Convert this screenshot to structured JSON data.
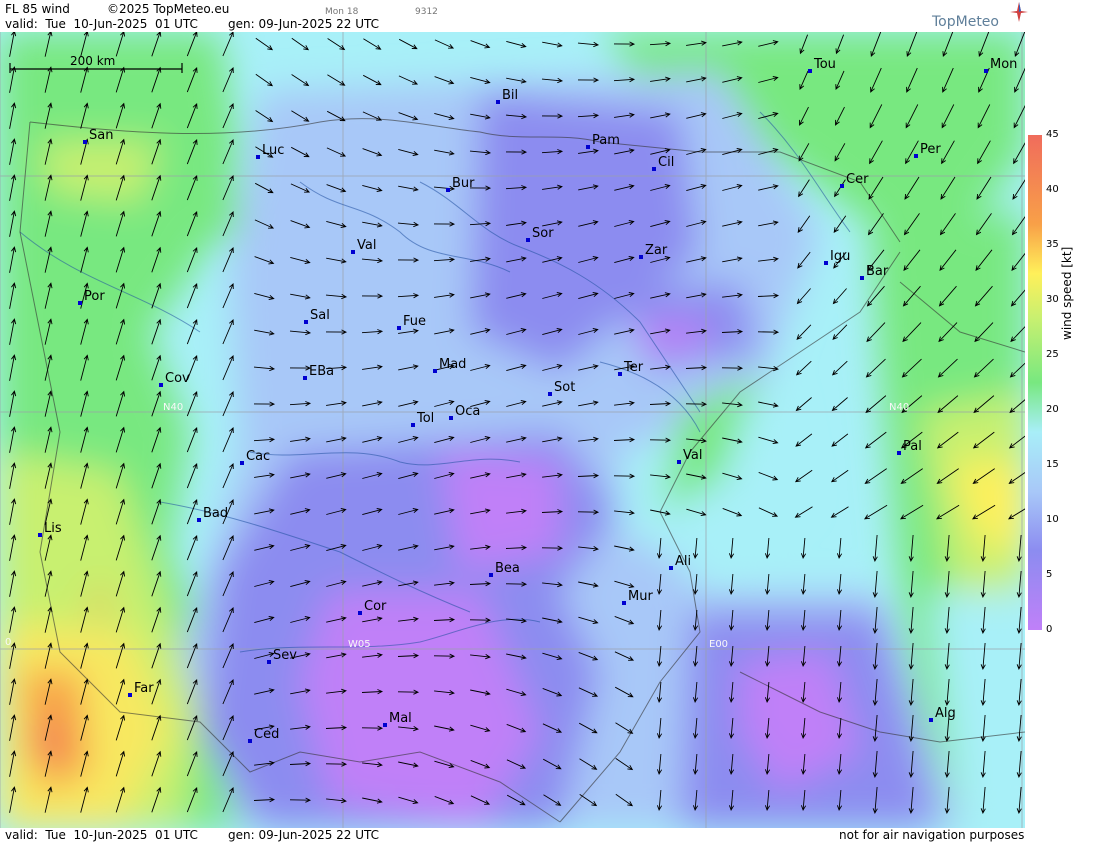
{
  "header": {
    "product": "FL 85 wind",
    "copyright": "©2025 TopMeteo.eu",
    "model_tag": "Mon 18",
    "code": "9312",
    "valid": "valid:  Tue  10-Jun-2025  01 UTC",
    "gen": "gen: 09-Jun-2025 22 UTC"
  },
  "brand": {
    "name": "TopMeteo"
  },
  "map": {
    "scale_label": "200 km",
    "grid_labels": [
      "N40",
      "N40",
      "W05",
      "E00",
      "0"
    ],
    "cities": [
      {
        "name": "Bil"
      },
      {
        "name": "Tou"
      },
      {
        "name": "Mon"
      },
      {
        "name": "San"
      },
      {
        "name": "Luc"
      },
      {
        "name": "Pam"
      },
      {
        "name": "Cil"
      },
      {
        "name": "Per"
      },
      {
        "name": "Bur"
      },
      {
        "name": "Cer"
      },
      {
        "name": "Sor"
      },
      {
        "name": "Val"
      },
      {
        "name": "Zar"
      },
      {
        "name": "Igu"
      },
      {
        "name": "Bar"
      },
      {
        "name": "Por"
      },
      {
        "name": "Sal"
      },
      {
        "name": "Fue"
      },
      {
        "name": "Mad"
      },
      {
        "name": "Cov"
      },
      {
        "name": "EBa"
      },
      {
        "name": "Sot"
      },
      {
        "name": "Ter"
      },
      {
        "name": "Tol"
      },
      {
        "name": "Oca"
      },
      {
        "name": "Pal"
      },
      {
        "name": "Cac"
      },
      {
        "name": "Val"
      },
      {
        "name": "Bad"
      },
      {
        "name": "Lis"
      },
      {
        "name": "Bea"
      },
      {
        "name": "Ali"
      },
      {
        "name": "Cor"
      },
      {
        "name": "Mur"
      },
      {
        "name": "Sev"
      },
      {
        "name": "Far"
      },
      {
        "name": "Mal"
      },
      {
        "name": "Alg"
      },
      {
        "name": "Ced"
      }
    ]
  },
  "legend": {
    "title": "wind speed [kt]",
    "ticks": [
      "45",
      "40",
      "35",
      "30",
      "25",
      "20",
      "15",
      "10",
      "5",
      "0"
    ],
    "colors": [
      "#f06c5c",
      "#f8a048",
      "#fff05a",
      "#c8f070",
      "#78e880",
      "#a8eef8",
      "#a8c8f8",
      "#8c8cf0",
      "#c080f8"
    ]
  },
  "footer": {
    "valid": "valid:  Tue  10-Jun-2025  01 UTC",
    "gen": "gen: 09-Jun-2025 22 UTC",
    "disclaimer": "not for air navigation purposes"
  }
}
